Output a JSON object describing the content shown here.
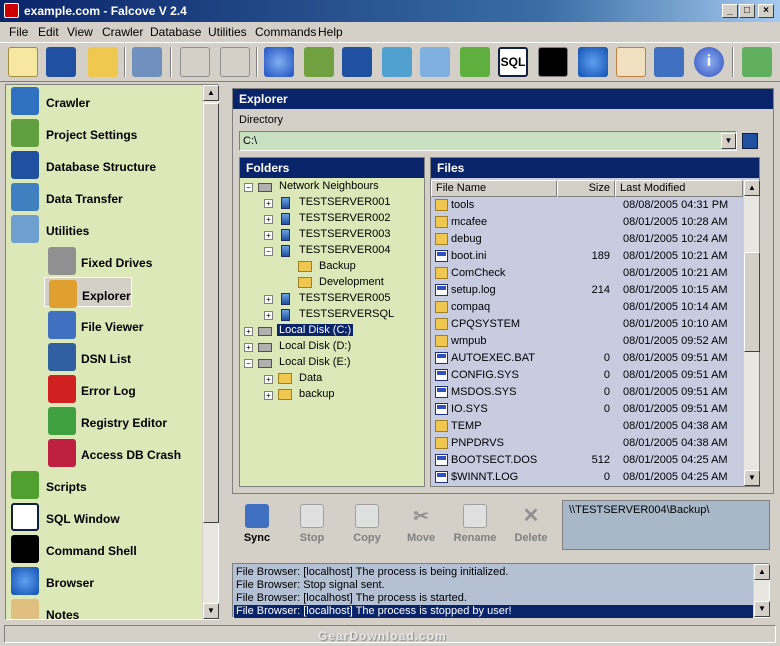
{
  "window": {
    "title": "example.com - Falcove V 2.4"
  },
  "menu": [
    "File",
    "Edit",
    "View",
    "Crawler",
    "Database",
    "Utilities",
    "Commands",
    "Help"
  ],
  "nav": {
    "items": [
      {
        "label": "Crawler",
        "icon": "crawler-globe-icon",
        "color": "#3070c0"
      },
      {
        "label": "Project Settings",
        "icon": "project-settings-icon",
        "color": "#60a040"
      },
      {
        "label": "Database Structure",
        "icon": "database-book-icon",
        "color": "#2050a0"
      },
      {
        "label": "Data Transfer",
        "icon": "data-transfer-icon",
        "color": "#4080c0"
      },
      {
        "label": "Utilities",
        "icon": "utilities-tools-icon",
        "color": "#70a0d0"
      }
    ],
    "subitems": [
      {
        "label": "Fixed Drives",
        "icon": "hard-drive-icon",
        "color": "#909090"
      },
      {
        "label": "Explorer",
        "icon": "explorer-folder-icon",
        "color": "#e0a030"
      },
      {
        "label": "File Viewer",
        "icon": "file-viewer-icon",
        "color": "#4070c0"
      },
      {
        "label": "DSN List",
        "icon": "dsn-server-icon",
        "color": "#3060a0"
      },
      {
        "label": "Error Log",
        "icon": "error-log-icon",
        "color": "#d02020"
      },
      {
        "label": "Registry Editor",
        "icon": "registry-editor-icon",
        "color": "#40a040"
      },
      {
        "label": "Access DB Crash",
        "icon": "access-db-crash-icon",
        "color": "#c02040"
      }
    ],
    "items2": [
      {
        "label": "Scripts",
        "icon": "scripts-icon",
        "color": "#50a030"
      },
      {
        "label": "SQL Window",
        "icon": "sql-window-icon",
        "color": "#102040"
      },
      {
        "label": "Command Shell",
        "icon": "command-shell-icon",
        "color": "#000000"
      },
      {
        "label": "Browser",
        "icon": "browser-ie-icon",
        "color": "#2070d0"
      },
      {
        "label": "Notes",
        "icon": "notes-icon",
        "color": "#e0c080"
      }
    ]
  },
  "explorer": {
    "title": "Explorer",
    "directory_label": "Directory",
    "directory_value": "C:\\",
    "folders_title": "Folders",
    "files_title": "Files",
    "tree": [
      {
        "label": "Network Neighbours",
        "level": 0,
        "type": "network",
        "exp": "-"
      },
      {
        "label": "TESTSERVER001",
        "level": 1,
        "type": "server",
        "exp": "+"
      },
      {
        "label": "TESTSERVER002",
        "level": 1,
        "type": "server",
        "exp": "+"
      },
      {
        "label": "TESTSERVER003",
        "level": 1,
        "type": "server",
        "exp": "+"
      },
      {
        "label": "TESTSERVER004",
        "level": 1,
        "type": "server",
        "exp": "-"
      },
      {
        "label": "Backup",
        "level": 2,
        "type": "folder",
        "exp": ""
      },
      {
        "label": "Development",
        "level": 2,
        "type": "folder",
        "exp": ""
      },
      {
        "label": "TESTSERVER005",
        "level": 1,
        "type": "server",
        "exp": "+"
      },
      {
        "label": "TESTSERVERSQL",
        "level": 1,
        "type": "server",
        "exp": "+"
      },
      {
        "label": "Local Disk (C:)",
        "level": 0,
        "type": "disk",
        "exp": "+",
        "selected": true
      },
      {
        "label": "Local Disk (D:)",
        "level": 0,
        "type": "disk",
        "exp": "+"
      },
      {
        "label": "Local Disk (E:)",
        "level": 0,
        "type": "disk",
        "exp": "-"
      },
      {
        "label": "Data",
        "level": 1,
        "type": "folder",
        "exp": "+"
      },
      {
        "label": "backup",
        "level": 1,
        "type": "folder",
        "exp": "+"
      }
    ],
    "columns": {
      "name": "File Name",
      "size": "Size",
      "modified": "Last Modified"
    },
    "files": [
      {
        "name": "tools",
        "size": "",
        "modified": "08/08/2005  04:31 PM",
        "type": "folder"
      },
      {
        "name": "mcafee",
        "size": "",
        "modified": "08/01/2005  10:28 AM",
        "type": "folder"
      },
      {
        "name": "debug",
        "size": "",
        "modified": "08/01/2005  10:24 AM",
        "type": "folder"
      },
      {
        "name": "boot.ini",
        "size": "189",
        "modified": "08/01/2005  10:21 AM",
        "type": "file"
      },
      {
        "name": "ComCheck",
        "size": "",
        "modified": "08/01/2005  10:21 AM",
        "type": "folder"
      },
      {
        "name": "setup.log",
        "size": "214",
        "modified": "08/01/2005  10:15 AM",
        "type": "file"
      },
      {
        "name": "compaq",
        "size": "",
        "modified": "08/01/2005  10:14 AM",
        "type": "folder"
      },
      {
        "name": "CPQSYSTEM",
        "size": "",
        "modified": "08/01/2005  10:10 AM",
        "type": "folder"
      },
      {
        "name": "wmpub",
        "size": "",
        "modified": "08/01/2005  09:52 AM",
        "type": "folder"
      },
      {
        "name": "AUTOEXEC.BAT",
        "size": "0",
        "modified": "08/01/2005  09:51 AM",
        "type": "file"
      },
      {
        "name": "CONFIG.SYS",
        "size": "0",
        "modified": "08/01/2005  09:51 AM",
        "type": "file"
      },
      {
        "name": "MSDOS.SYS",
        "size": "0",
        "modified": "08/01/2005  09:51 AM",
        "type": "file"
      },
      {
        "name": "IO.SYS",
        "size": "0",
        "modified": "08/01/2005  09:51 AM",
        "type": "file"
      },
      {
        "name": "TEMP",
        "size": "",
        "modified": "08/01/2005  04:38 AM",
        "type": "folder"
      },
      {
        "name": "PNPDRVS",
        "size": "",
        "modified": "08/01/2005  04:38 AM",
        "type": "folder"
      },
      {
        "name": "BOOTSECT.DOS",
        "size": "512",
        "modified": "08/01/2005  04:25 AM",
        "type": "file"
      },
      {
        "name": "$WINNT.LOG",
        "size": "0",
        "modified": "08/01/2005  04:25 AM",
        "type": "file"
      }
    ]
  },
  "actions": [
    {
      "label": "Sync",
      "icon": "sync-icon",
      "enabled": true
    },
    {
      "label": "Stop",
      "icon": "stop-icon",
      "enabled": false
    },
    {
      "label": "Copy",
      "icon": "copy-icon",
      "enabled": false
    },
    {
      "label": "Move",
      "icon": "move-scissors-icon",
      "enabled": false
    },
    {
      "label": "Rename",
      "icon": "rename-icon",
      "enabled": false
    },
    {
      "label": "Delete",
      "icon": "delete-x-icon",
      "enabled": false
    }
  ],
  "path_display": "\\\\TESTSERVER004\\Backup\\",
  "log": [
    "File Browser: [localhost] The process is being initialized.",
    "File Browser: Stop signal sent.",
    "File Browser: [localhost] The process is started.",
    "File Browser: [localhost] The process is stopped by user!"
  ],
  "watermark": "GearDownload.com",
  "colors": {
    "nav_bg": "#dde8b8",
    "title_blue": "#0a246a",
    "files_bg": "#c8cce0",
    "selected": "#0a246a"
  }
}
